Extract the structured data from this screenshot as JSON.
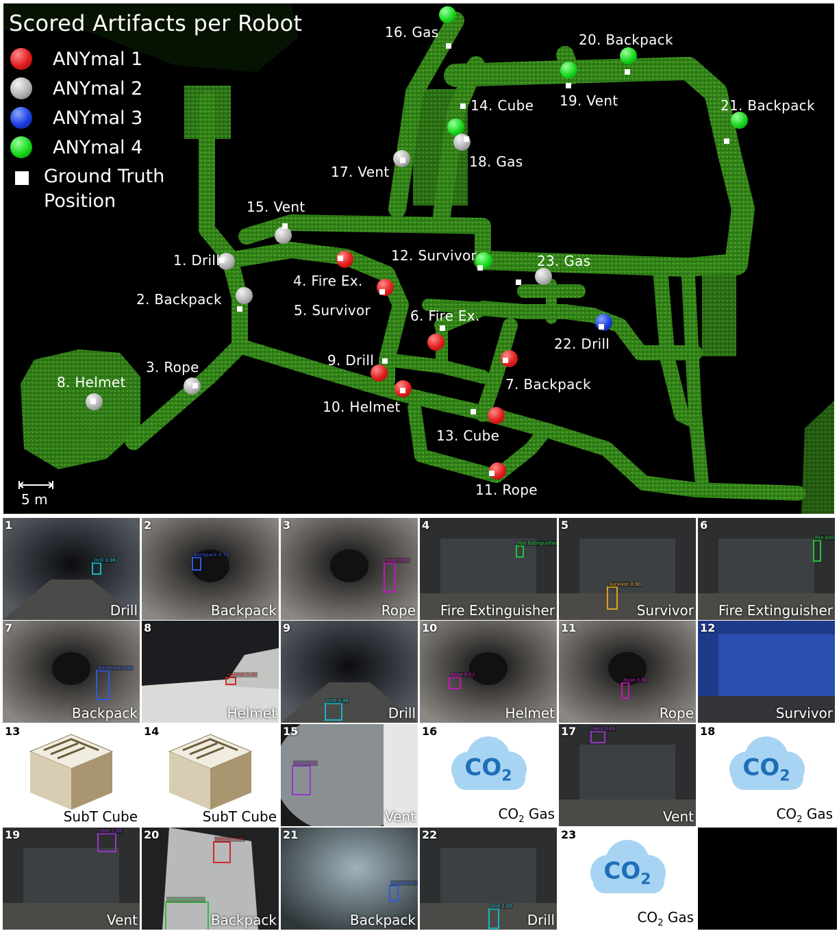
{
  "map": {
    "title": "Scored Artifacts per Robot",
    "legend": [
      {
        "label": "ANYmal 1",
        "color": "#e11d1d"
      },
      {
        "label": "ANYmal 2",
        "color": "#b3b3b3"
      },
      {
        "label": "ANYmal 3",
        "color": "#1a3fe0"
      },
      {
        "label": "ANYmal 4",
        "color": "#15d81b"
      }
    ],
    "ground_truth_label_1": "Ground Truth",
    "ground_truth_label_2": "Position",
    "scale_label": "5 m",
    "tunnel_color": "#3d9a1e",
    "artifacts": [
      {
        "label": "1. Drill",
        "robot": 2
      },
      {
        "label": "2. Backpack",
        "robot": 2
      },
      {
        "label": "3. Rope",
        "robot": 2
      },
      {
        "label": "4. Fire Ex.",
        "robot": 1
      },
      {
        "label": "5. Survivor",
        "robot": 1
      },
      {
        "label": "6. Fire Ex.",
        "robot": 1
      },
      {
        "label": "7. Backpack",
        "robot": 1
      },
      {
        "label": "8. Helmet",
        "robot": 2
      },
      {
        "label": "9. Drill",
        "robot": 1
      },
      {
        "label": "10. Helmet",
        "robot": 1
      },
      {
        "label": "11. Rope",
        "robot": 1
      },
      {
        "label": "12. Survivor",
        "robot": 4
      },
      {
        "label": "13. Cube",
        "robot": 1
      },
      {
        "label": "14. Cube",
        "robot": 4
      },
      {
        "label": "15. Vent",
        "robot": 2
      },
      {
        "label": "16. Gas",
        "robot": 4
      },
      {
        "label": "17. Vent",
        "robot": 2
      },
      {
        "label": "18. Gas",
        "robot": 2
      },
      {
        "label": "19. Vent",
        "robot": 4
      },
      {
        "label": "20. Backpack",
        "robot": 4
      },
      {
        "label": "21. Backpack",
        "robot": 4
      },
      {
        "label": "22. Drill",
        "robot": 3
      },
      {
        "label": "23. Gas",
        "robot": 2
      }
    ]
  },
  "tiles": [
    {
      "num": "1",
      "caption": "Drill",
      "detection": "Drill 0.96"
    },
    {
      "num": "2",
      "caption": "Backpack",
      "detection": "Backpack 0.70"
    },
    {
      "num": "3",
      "caption": "Rope",
      "detection": "Rope 0.98"
    },
    {
      "num": "4",
      "caption": "Fire Extinguisher",
      "detection": "Fire Extinguisher 0.77"
    },
    {
      "num": "5",
      "caption": "Survivor",
      "detection": "Survivor 0.90"
    },
    {
      "num": "6",
      "caption": "Fire Extinguisher",
      "detection": "Fire Extinguisher 0.73"
    },
    {
      "num": "7",
      "caption": "Backpack",
      "detection": "Backpack 0.99"
    },
    {
      "num": "8",
      "caption": "Helmet",
      "detection": "Helmet 0.90"
    },
    {
      "num": "9",
      "caption": "Drill",
      "detection": "Drill 0.99"
    },
    {
      "num": "10",
      "caption": "Helmet",
      "detection": "Rope 0.52"
    },
    {
      "num": "11",
      "caption": "Rope",
      "detection": "Rope 0.50"
    },
    {
      "num": "12",
      "caption": "Survivor",
      "detection": ""
    },
    {
      "num": "13",
      "caption": "SubT Cube",
      "detection": ""
    },
    {
      "num": "14",
      "caption": "SubT Cube",
      "detection": ""
    },
    {
      "num": "15",
      "caption": "Vent",
      "detection": "Vent 0.89"
    },
    {
      "num": "16",
      "caption": "CO",
      "caption_sub": "2",
      "caption_tail": " Gas",
      "co2": "CO",
      "co2_sub": "2"
    },
    {
      "num": "17",
      "caption": "Vent",
      "detection": "Vent 0.69"
    },
    {
      "num": "18",
      "caption": "CO",
      "caption_sub": "2",
      "caption_tail": " Gas",
      "co2": "CO",
      "co2_sub": "2"
    },
    {
      "num": "19",
      "caption": "Vent",
      "detection": "Vent 1.00"
    },
    {
      "num": "20",
      "caption": "Backpack",
      "detection": "Helmet 0.60",
      "detection2": "Cell Phone 0.93"
    },
    {
      "num": "21",
      "caption": "Backpack",
      "detection": "Backpack 0.70"
    },
    {
      "num": "22",
      "caption": "Drill",
      "detection": "Drill 1.00"
    },
    {
      "num": "23",
      "caption": "CO",
      "caption_sub": "2",
      "caption_tail": " Gas",
      "co2": "CO",
      "co2_sub": "2"
    }
  ]
}
